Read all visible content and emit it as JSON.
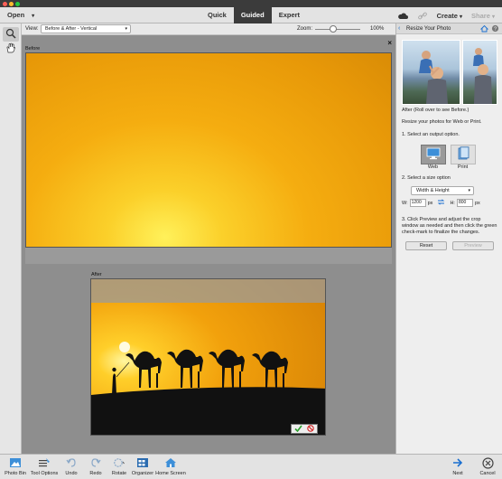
{
  "topbar": {
    "open_label": "Open",
    "modes": [
      "Quick",
      "Guided",
      "Expert"
    ],
    "active_mode": "Guided",
    "create_label": "Create",
    "share_label": "Share"
  },
  "toolbar": {
    "view_label": "View:",
    "view_value": "Before & After - Vertical",
    "zoom_label": "Zoom:",
    "zoom_value": "100%",
    "zoom_level_fraction": 0.4
  },
  "canvas": {
    "before_label": "Before",
    "after_label": "After"
  },
  "panel": {
    "title": "Resize Your Photo",
    "preview_caption": "After (Roll over to see Before.)",
    "intro": "Resize your photos for Web or Print.",
    "step1": "1. Select an output option.",
    "output_options": [
      {
        "label": "Web",
        "selected": true
      },
      {
        "label": "Print",
        "selected": false
      }
    ],
    "step2": "2. Select a size option",
    "size_option": "Width & Height",
    "width_label": "W:",
    "width_value": "1200",
    "width_unit": "px",
    "height_label": "H:",
    "height_value": "800",
    "height_unit": "px",
    "step3_line1": "3. Click Preview and adjust the crop",
    "step3_line2": "window as needed and then click the green",
    "step3_line3": "check-mark to finalize the changes.",
    "reset_label": "Reset",
    "preview_label": "Preview"
  },
  "bottombar": {
    "photo_bin": "Photo Bin",
    "tool_options": "Tool Options",
    "undo": "Undo",
    "redo": "Redo",
    "rotate": "Rotate",
    "organizer": "Organizer",
    "home_screen": "Home Screen",
    "next": "Next",
    "cancel": "Cancel"
  },
  "colors": {
    "accent_blue": "#1a6fd0",
    "active_tab_bg": "#3b3b3b",
    "confirm_green": "#2e9e2e",
    "cancel_red": "#d22020"
  }
}
